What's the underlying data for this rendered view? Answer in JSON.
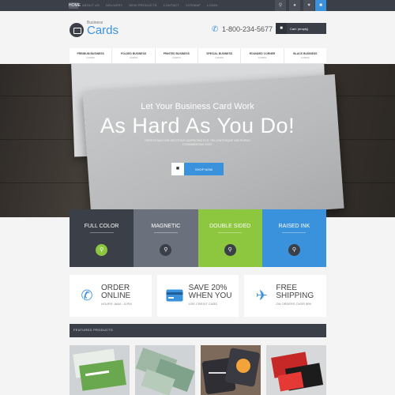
{
  "topbar": {
    "home_label": "HOME",
    "links": [
      "ABOUT US",
      "DELIVERY",
      "NEW PRODUCTS",
      "CONTACT",
      "SITEMAP",
      "LOGIN"
    ],
    "buttons": [
      "search-icon",
      "user-icon",
      "heart-icon",
      "cart-icon"
    ]
  },
  "header": {
    "logo_small": "Business",
    "logo_main": "Cards",
    "phone": "1-800-234-5677",
    "cart_label": "Cart: (empty)"
  },
  "nav": [
    {
      "label": "PREMIUM BUSINESS",
      "sub": "CARDS"
    },
    {
      "label": "FOLDED BUSINESS",
      "sub": "CARDS"
    },
    {
      "label": "PRINTED BUSINESS",
      "sub": "CARDS"
    },
    {
      "label": "SPECIAL BUSINESS",
      "sub": "CARDS"
    },
    {
      "label": "ROUNDED CORNER",
      "sub": "CARDS"
    },
    {
      "label": "BLACK BUSINESS",
      "sub": "CARDS"
    }
  ],
  "hero": {
    "subtitle": "Let Your Business Card Work",
    "title": "As Hard As You Do!",
    "body": "DEER ETIAM CON SECTETUR ADIPISCING ELIT. PELLENTESQUE NISI PURUS CONDIMENTUM EGET",
    "button_label": "SHOP NOW"
  },
  "tiles": [
    {
      "title": "FULL COLOR",
      "bg": "#3b3f47",
      "icon_bg": "#8dc63f"
    },
    {
      "title": "MAGNETIC",
      "bg": "#6b717c",
      "icon_bg": "#3b3f47"
    },
    {
      "title": "DOUBLE SIDED",
      "bg": "#8dc63f",
      "icon_bg": "#3b3f47"
    },
    {
      "title": "RAISED INK",
      "bg": "#3a92dd",
      "icon_bg": "#3b3f47"
    }
  ],
  "infos": [
    {
      "icon": "phone-icon",
      "line1": "ORDER",
      "line2": "ONLINE",
      "line3": "HOURS: 8AM - 11PM"
    },
    {
      "icon": "credit-card-icon",
      "line1": "SAVE 20%",
      "line2": "WHEN YOU",
      "line3": "USE CREDIT CARD"
    },
    {
      "icon": "airplane-icon",
      "line1": "FREE",
      "line2": "SHIPPING",
      "line3": "ON ORDERS OVER $99"
    }
  ],
  "featured": {
    "title": "FEATURED PRODUCTS"
  },
  "colors": {
    "accent": "#3a92dd",
    "dark": "#3b3f47",
    "green": "#8dc63f",
    "gray": "#6b717c"
  }
}
